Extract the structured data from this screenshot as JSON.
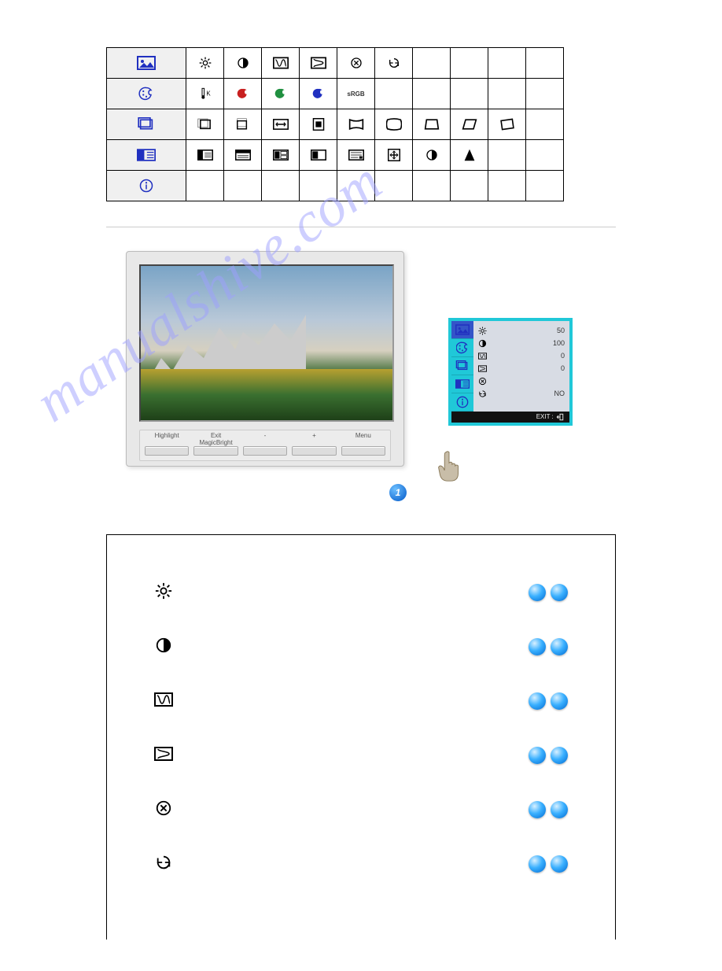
{
  "menu_table": {
    "rows": [
      {
        "header_icon": "picture-icon",
        "cells": [
          "brightness-icon",
          "contrast-icon",
          "h-moire-icon",
          "v-moire-icon",
          "degauss-icon",
          "recall-icon",
          "",
          "",
          "",
          ""
        ]
      },
      {
        "header_icon": "color-icon",
        "cells": [
          "colortemp-icon",
          "red-icon",
          "green-icon",
          "blue-icon",
          "srgb-text",
          "",
          "",
          "",
          "",
          ""
        ]
      },
      {
        "header_icon": "geometry-icon",
        "cells": [
          "hpos-icon",
          "vpos-icon",
          "hsize-icon",
          "vsize-icon",
          "pincushion-icon",
          "trapezoid-icon",
          "pinbalance-icon",
          "parallel-icon",
          "rotation-icon",
          ""
        ]
      },
      {
        "header_icon": "screen-icon",
        "cells": [
          "menuh-icon",
          "menuv-icon",
          "lang-icon",
          "halftone-icon",
          "osd-icon",
          "zoom-icon",
          "contrast-icon",
          "sharpness-icon",
          "",
          ""
        ]
      },
      {
        "header_icon": "info-icon",
        "cells": [
          "",
          "",
          "",
          "",
          "",
          "",
          "",
          "",
          "",
          ""
        ]
      }
    ]
  },
  "monitor": {
    "buttons": {
      "b1": "Highlight",
      "b2_line1": "Exit",
      "b2_line2": "MagicBright",
      "b3": "-",
      "b4": "+",
      "b5": "Menu"
    }
  },
  "badge": "1",
  "osd": {
    "rows": [
      {
        "icon": "brightness-icon",
        "value": "50"
      },
      {
        "icon": "contrast-icon",
        "value": "100"
      },
      {
        "icon": "h-moire-icon",
        "value": "0"
      },
      {
        "icon": "v-moire-icon",
        "value": "0"
      },
      {
        "icon": "degauss-icon",
        "value": ""
      },
      {
        "icon": "recall-icon",
        "value": "NO"
      }
    ],
    "footer": "EXIT : "
  },
  "watermark": "manualshive.com",
  "features": [
    {
      "icon": "brightness-icon"
    },
    {
      "icon": "contrast-icon"
    },
    {
      "icon": "h-moire-icon"
    },
    {
      "icon": "v-moire-icon"
    },
    {
      "icon": "degauss-icon"
    },
    {
      "icon": "recall-icon"
    }
  ]
}
